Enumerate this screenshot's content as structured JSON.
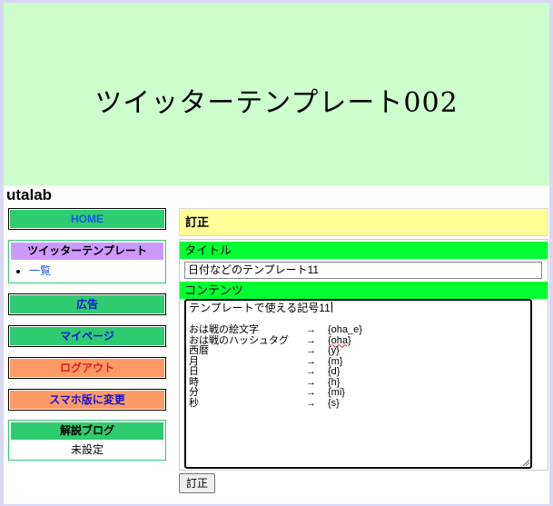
{
  "banner": {
    "title": "ツイッターテンプレート002"
  },
  "site": {
    "name": "utalab"
  },
  "sidebar": {
    "home": "HOME",
    "twitter_box": {
      "title": "ツイッターテンプレート",
      "items": [
        "一覧"
      ]
    },
    "ads": "広告",
    "mypage": "マイページ",
    "logout": "ログアウト",
    "mobile": "スマホ版に変更",
    "blog_box": {
      "title": "解説ブログ",
      "note": "未設定"
    }
  },
  "main": {
    "heading": "訂正",
    "title_label": "タイトル",
    "title_value": "日付などのテンプレート11",
    "content_label": "コンテンツ",
    "content_first_line": "テンプレートで使える記号11",
    "arrow": "→",
    "rows": [
      {
        "key": "おは戦の絵文字",
        "value": "{oha_e}"
      },
      {
        "key": "おは戦のハッシュタグ",
        "value": "{oha}"
      },
      {
        "key": "西暦",
        "value": "{y}"
      },
      {
        "key": "月",
        "value": "{m}"
      },
      {
        "key": "日",
        "value": "{d}"
      },
      {
        "key": "時",
        "value": "{h}"
      },
      {
        "key": "分",
        "value": "{mi}"
      },
      {
        "key": "秒",
        "value": "{s}"
      }
    ],
    "submit": "訂正"
  },
  "colors": {
    "banner_bg": "#ccffcc",
    "sidebar_green": "#2ecc71",
    "sidebar_orange": "#ff9966",
    "twitter_box_head": "#cc99ff",
    "heading_bg": "#ffff99",
    "field_bar": "#00ff33"
  }
}
